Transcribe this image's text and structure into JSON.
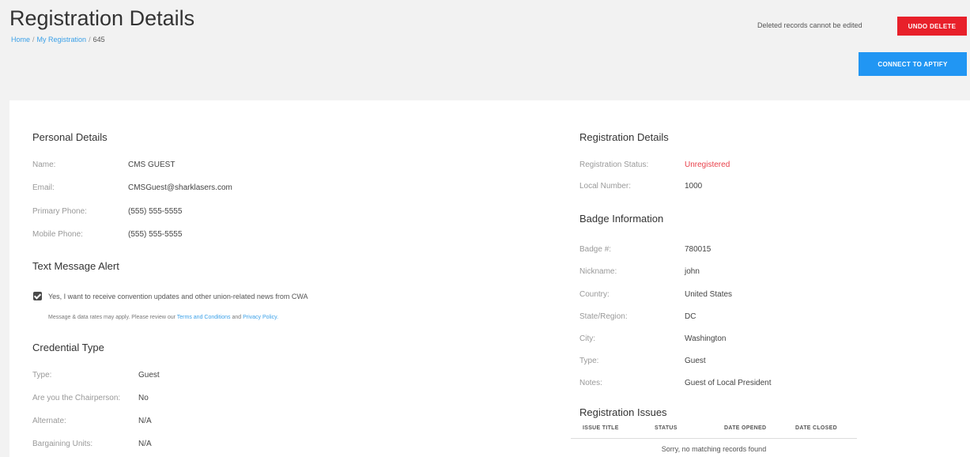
{
  "header": {
    "title": "Registration Details",
    "breadcrumb": {
      "home": "Home",
      "my_registration": "My Registration",
      "separator": "/",
      "current": "645"
    },
    "deleted_note": "Deleted records cannot be edited",
    "undo_delete_label": "UNDO DELETE",
    "connect_label": "CONNECT TO APTIFY"
  },
  "personal": {
    "title": "Personal Details",
    "name_label": "Name:",
    "name": "CMS GUEST",
    "email_label": "Email:",
    "email": "CMSGuest@sharklasers.com",
    "primary_phone_label": "Primary Phone:",
    "primary_phone": "(555) 555-5555",
    "mobile_phone_label": "Mobile Phone:",
    "mobile_phone": "(555) 555-5555"
  },
  "text_alert": {
    "title": "Text Message Alert",
    "checked": true,
    "consent_text": "Yes, I want to receive convention updates and other union-related news from CWA",
    "rates_text": "Message & data rates may apply. Please review our",
    "terms_link": "Terms and Conditions",
    "and_text": "and",
    "privacy_link": "Privacy Policy."
  },
  "credential": {
    "title": "Credential Type",
    "type_label": "Type:",
    "type": "Guest",
    "chair_label": "Are you the Chairperson:",
    "chair": "No",
    "alternate_label": "Alternate:",
    "alternate": "N/A",
    "bargaining_label": "Bargaining Units:",
    "bargaining": "N/A"
  },
  "registration": {
    "title": "Registration Details",
    "status_label": "Registration Status:",
    "status": "Unregistered",
    "status_color": "#e8404a",
    "local_label": "Local Number:",
    "local": "1000"
  },
  "badge": {
    "title": "Badge Information",
    "number_label": "Badge #:",
    "number": "780015",
    "nickname_label": "Nickname:",
    "nickname": "john",
    "country_label": "Country:",
    "country": "United States",
    "state_label": "State/Region:",
    "state": "DC",
    "city_label": "City:",
    "city": "Washington",
    "type_label": "Type:",
    "type": "Guest",
    "notes_label": "Notes:",
    "notes": "Guest of Local President"
  },
  "issues": {
    "title": "Registration Issues",
    "columns": [
      "ISSUE TITLE",
      "STATUS",
      "DATE OPENED",
      "DATE CLOSED"
    ],
    "empty_text": "Sorry, no matching records found"
  },
  "colors": {
    "danger": "#e8202a",
    "primary": "#2196f3",
    "link": "#3aa0e8"
  }
}
